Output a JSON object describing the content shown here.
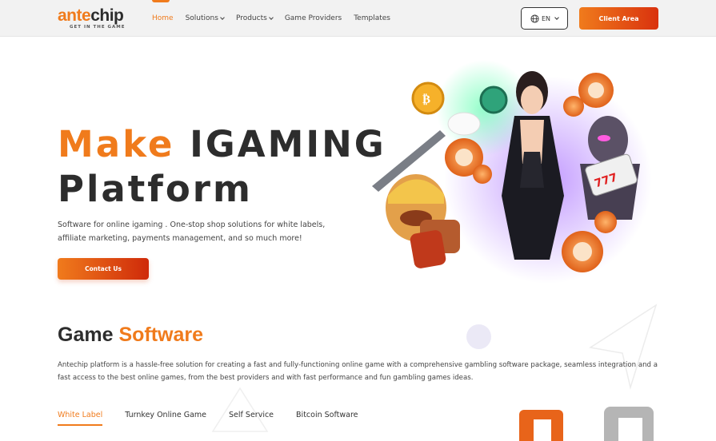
{
  "header": {
    "logo": {
      "ante": "ante",
      "chip": "chip",
      "tagline": "GET IN THE GAME"
    },
    "nav": [
      {
        "label": "Home",
        "active": true,
        "dropdown": false
      },
      {
        "label": "Solutions",
        "active": false,
        "dropdown": true
      },
      {
        "label": "Products",
        "active": false,
        "dropdown": true
      },
      {
        "label": "Game Providers",
        "active": false,
        "dropdown": false
      },
      {
        "label": "Templates",
        "active": false,
        "dropdown": false
      }
    ],
    "language": {
      "label": "EN",
      "icon": "globe-icon"
    },
    "client_area_label": "Client Area"
  },
  "hero": {
    "title_orange": "Make",
    "title_line1_rest": "IGAMING",
    "title_line2": "Platform",
    "description": "Software for online igaming . One-stop shop solutions for white labels, affiliate marketing, payments management, and so much more!",
    "cta_label": "Contact Us"
  },
  "game_software": {
    "title_dark": "Game",
    "title_orange": "Software",
    "description": "Antechip platform is a hassle-free solution for creating a fast and fully-functioning online game with a comprehensive gambling software package, seamless integration and a fast access to the best online games, from the best providers and with fast performance and fun gambling games ideas.",
    "tabs": [
      {
        "label": "White Label",
        "active": true
      },
      {
        "label": "Turnkey Online Game",
        "active": false
      },
      {
        "label": "Self Service",
        "active": false
      },
      {
        "label": "Bitcoin Software",
        "active": false
      }
    ]
  },
  "colors": {
    "accent": "#f07b1c",
    "accent_dark": "#cf2a0a",
    "text_dark": "#2d2d2d"
  }
}
